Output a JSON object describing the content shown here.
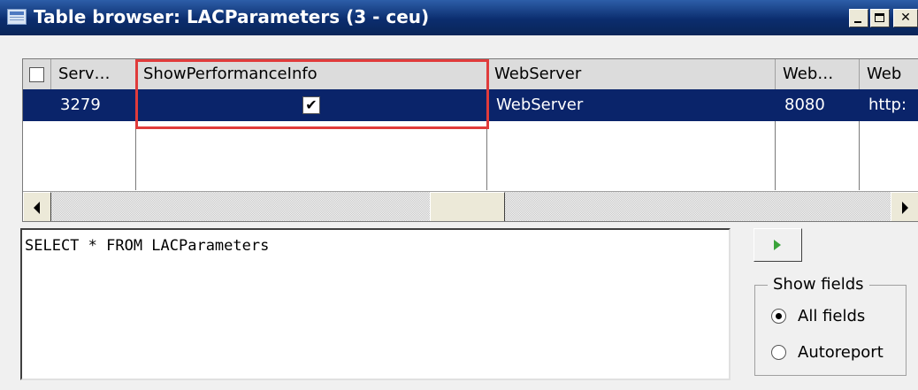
{
  "window": {
    "title": "Table browser: LACParameters (3 - ceu)"
  },
  "grid": {
    "columns": [
      "Serv…",
      "ShowPerformanceInfo",
      "WebServer",
      "Web…",
      "Web"
    ],
    "rows": [
      {
        "server": "3279",
        "show_performance_info": true,
        "webserver": "WebServer",
        "web_port": "8080",
        "web_url": "http:"
      }
    ]
  },
  "query": {
    "text": "SELECT * FROM LACParameters"
  },
  "show_fields": {
    "legend": "Show fields",
    "options": [
      {
        "label": "All fields",
        "selected": true
      },
      {
        "label": "Autoreport",
        "selected": false
      }
    ]
  },
  "colors": {
    "title_bar": "#0b2d6e",
    "selection": "#0a246a",
    "highlight": "#e03b3b"
  },
  "icons": [
    "table-browser-icon",
    "minimize-icon",
    "maximize-icon",
    "close-icon",
    "checkmark-icon",
    "arrow-left-icon",
    "arrow-right-icon",
    "run-icon"
  ]
}
